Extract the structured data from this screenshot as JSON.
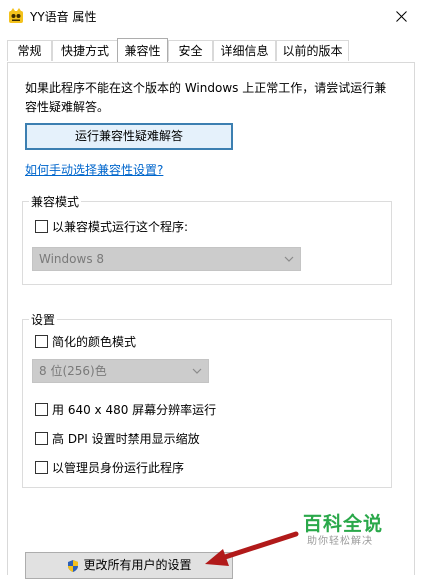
{
  "window": {
    "title": "YY语音 属性"
  },
  "tabs": [
    {
      "label": "常规"
    },
    {
      "label": "快捷方式"
    },
    {
      "label": "兼容性"
    },
    {
      "label": "安全"
    },
    {
      "label": "详细信息"
    },
    {
      "label": "以前的版本"
    }
  ],
  "compat": {
    "description": "如果此程序不能在这个版本的 Windows 上正常工作，请尝试运行兼容性疑难解答。",
    "troubleshoot_button": "运行兼容性疑难解答",
    "manual_link": "如何手动选择兼容性设置?",
    "mode_group": {
      "title": "兼容模式",
      "checkbox": "以兼容模式运行这个程序:",
      "select_value": "Windows 8"
    },
    "settings_group": {
      "title": "设置",
      "reduced_color": "简化的颜色模式",
      "color_select_value": "8 位(256)色",
      "res_640": "用 640 x 480 屏幕分辨率运行",
      "high_dpi": "高 DPI 设置时禁用显示缩放",
      "run_admin": "以管理员身份运行此程序"
    },
    "all_users_button": "更改所有用户的设置"
  },
  "watermark": {
    "main": "百科全说",
    "sub": "助你轻松解决"
  },
  "colors": {
    "arrow": "#b11a1a",
    "watermark": "#2aa84a",
    "link": "#0066cc"
  }
}
